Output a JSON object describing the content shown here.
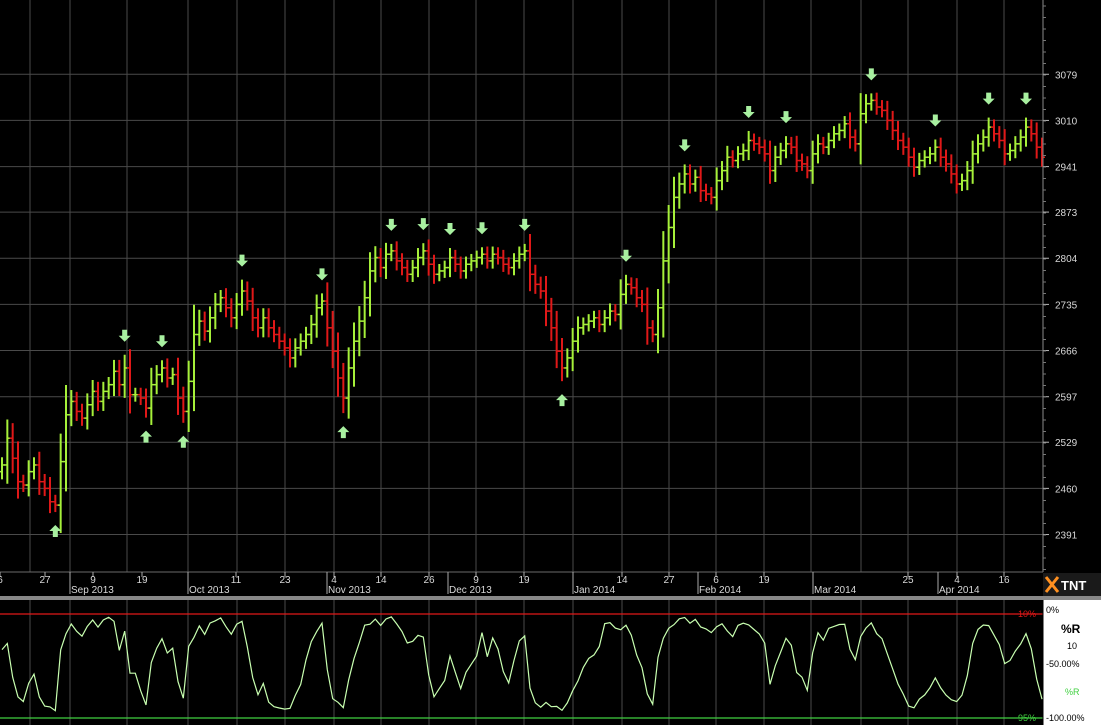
{
  "colors": {
    "background": "#000000",
    "grid": "#4a4a4a",
    "up_bar": "#a6f03a",
    "down_bar": "#e01818",
    "signal_arrow": "#a8f0a0",
    "oscillator_line": "#c8ffb0",
    "upper_threshold_line": "#e01818",
    "lower_threshold_line": "#40d040",
    "axis_panel": "#ffffff"
  },
  "logo_text": "TNT",
  "chart_data": [
    {
      "type": "ohlc",
      "y_ticks": [
        "3079",
        "3010",
        "2941",
        "2873",
        "2804",
        "2735",
        "2666",
        "2597",
        "2529",
        "2460",
        "2391"
      ],
      "ylim": [
        2335,
        3190
      ],
      "x_day_ticks": [
        "6",
        "27",
        "9",
        "19",
        "11",
        "23",
        "4",
        "14",
        "26",
        "9",
        "19",
        "14",
        "27",
        "6",
        "19",
        "25",
        "4",
        "16"
      ],
      "x_month_ticks": [
        "Sep 2013",
        "Oct 2013",
        "Nov 2013",
        "Dec 2013",
        "Jan 2014",
        "Feb 2014",
        "Mar 2014",
        "Apr 2014"
      ],
      "closes": [
        2495,
        2535,
        2505,
        2470,
        2465,
        2485,
        2495,
        2470,
        2460,
        2440,
        2435,
        2500,
        2570,
        2590,
        2575,
        2565,
        2585,
        2605,
        2590,
        2605,
        2615,
        2635,
        2615,
        2640,
        2600,
        2600,
        2595,
        2580,
        2615,
        2630,
        2640,
        2625,
        2630,
        2595,
        2575,
        2620,
        2690,
        2710,
        2695,
        2715,
        2735,
        2745,
        2730,
        2715,
        2735,
        2755,
        2740,
        2715,
        2700,
        2715,
        2700,
        2690,
        2680,
        2670,
        2655,
        2670,
        2680,
        2690,
        2705,
        2730,
        2740,
        2700,
        2665,
        2625,
        2595,
        2640,
        2680,
        2710,
        2745,
        2785,
        2805,
        2790,
        2810,
        2815,
        2800,
        2790,
        2780,
        2790,
        2805,
        2815,
        2795,
        2780,
        2785,
        2790,
        2805,
        2795,
        2785,
        2795,
        2800,
        2805,
        2810,
        2800,
        2810,
        2805,
        2795,
        2790,
        2800,
        2810,
        2815,
        2780,
        2765,
        2755,
        2725,
        2700,
        2665,
        2640,
        2655,
        2680,
        2700,
        2705,
        2710,
        2715,
        2705,
        2715,
        2725,
        2720,
        2750,
        2765,
        2760,
        2745,
        2735,
        2700,
        2690,
        2730,
        2800,
        2850,
        2895,
        2915,
        2930,
        2915,
        2925,
        2905,
        2900,
        2895,
        2920,
        2935,
        2955,
        2950,
        2960,
        2965,
        2980,
        2975,
        2970,
        2960,
        2935,
        2955,
        2965,
        2975,
        2970,
        2950,
        2945,
        2935,
        2960,
        2975,
        2970,
        2980,
        2990,
        2995,
        3005,
        2985,
        2975,
        3020,
        3035,
        3040,
        3030,
        3025,
        3010,
        2995,
        2980,
        2970,
        2955,
        2940,
        2950,
        2955,
        2960,
        2970,
        2955,
        2945,
        2930,
        2915,
        2920,
        2935,
        2960,
        2975,
        2985,
        3000,
        2990,
        2980,
        2960,
        2965,
        2975,
        2985,
        3000,
        2990,
        2970,
        2955
      ]
    },
    {
      "type": "line",
      "title": "%R",
      "period": "10",
      "series_name": "%R",
      "y_axis_labels": [
        "0%",
        "-50.00%",
        "-100.00%"
      ],
      "upper_threshold_label": "10%",
      "lower_threshold_label": "95%",
      "ylim": [
        -100,
        0
      ]
    }
  ]
}
